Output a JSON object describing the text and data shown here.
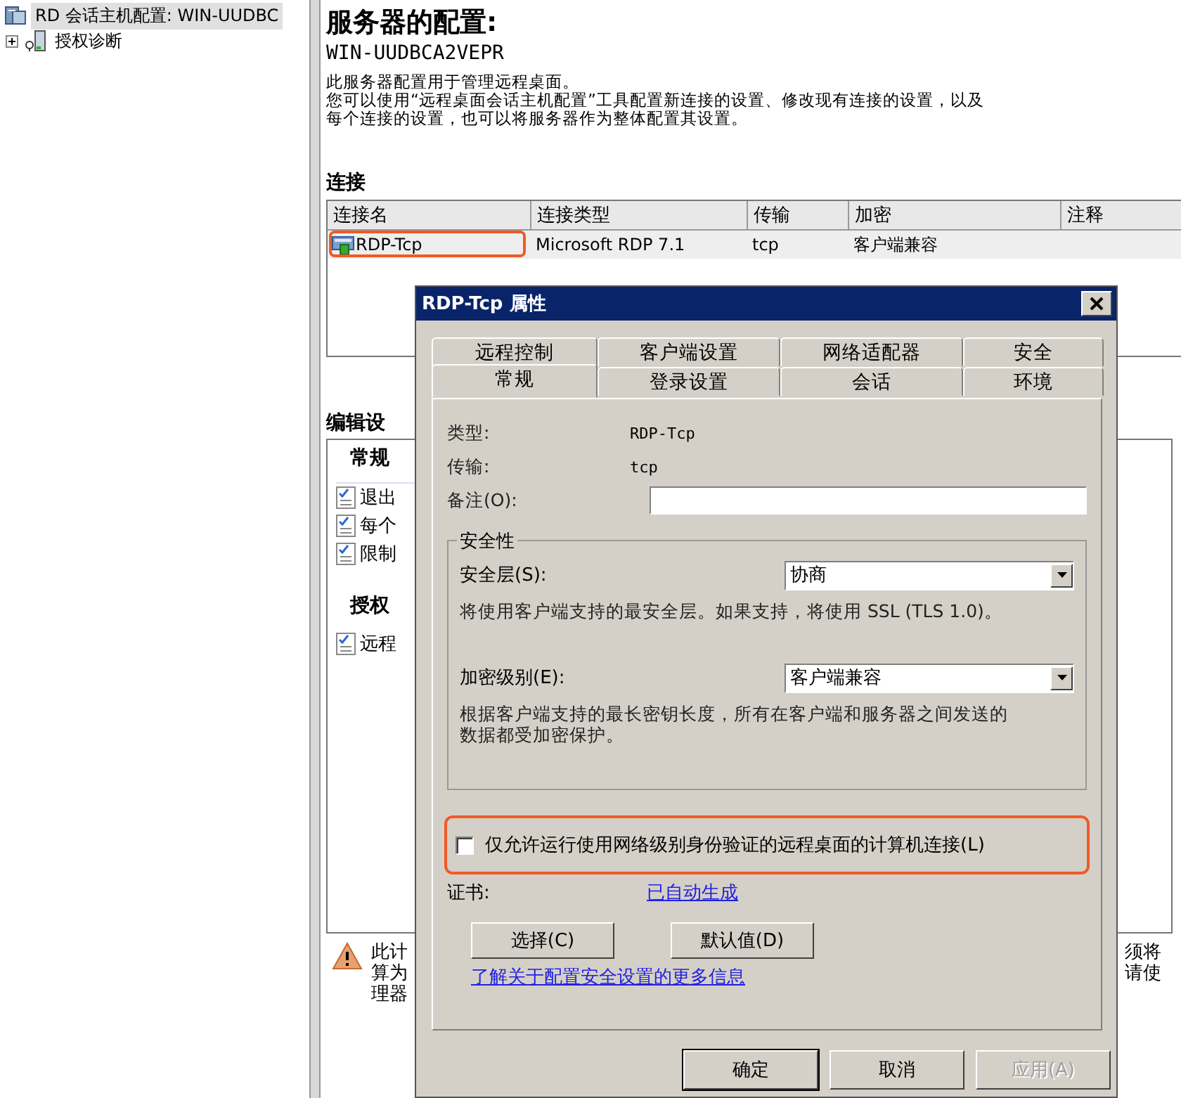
{
  "tree": {
    "items": [
      {
        "label": "RD 会话主机配置: WIN-UUDBC",
        "selected": true,
        "collapsed": false
      },
      {
        "label": "授权诊断",
        "selected": false,
        "collapsed": true
      }
    ]
  },
  "server": {
    "title": "服务器的配置:",
    "name": "WIN-UUDBCA2VEPR",
    "description": [
      "此服务器配置用于管理远程桌面。",
      "您可以使用“远程桌面会话主机配置”工具配置新连接的设置、修改现有连接的设置，以及",
      "每个连接的设置，也可以将服务器作为整体配置其设置。"
    ]
  },
  "connections": {
    "heading": "连接",
    "columns": [
      "连接名",
      "连接类型",
      "传输",
      "加密",
      "注释"
    ],
    "rows": [
      {
        "cells": [
          "RDP-Tcp",
          "Microsoft RDP 7.1",
          "tcp",
          "客户端兼容"
        ],
        "highlighted": true
      }
    ]
  },
  "edit_settings": {
    "heading": "编辑设",
    "groups": [
      {
        "title": "常规",
        "items": [
          "退出",
          "每个",
          "限制"
        ]
      },
      {
        "title": "授权",
        "items": [
          "远程"
        ]
      }
    ]
  },
  "warning": {
    "left_lines": [
      "此计",
      "算为",
      "理器"
    ],
    "right_lines": [
      "须将",
      "请使"
    ]
  },
  "dialog": {
    "title": "RDP-Tcp 属性",
    "tab_rows": [
      [
        {
          "label": "远程控制",
          "selected": false
        },
        {
          "label": "客户端设置",
          "selected": false
        },
        {
          "label": "网络适配器",
          "selected": false
        },
        {
          "label": "安全",
          "selected": false
        }
      ],
      [
        {
          "label": "常规",
          "selected": true
        },
        {
          "label": "登录设置",
          "selected": false
        },
        {
          "label": "会话",
          "selected": false
        },
        {
          "label": "环境",
          "selected": false
        }
      ]
    ],
    "fields": [
      {
        "kind": "readonly",
        "label": "类型:",
        "value": "RDP-Tcp"
      },
      {
        "kind": "readonly",
        "label": "传输:",
        "value": "tcp"
      },
      {
        "kind": "input",
        "label": "备注(O):"
      }
    ],
    "security": {
      "title": "安全性",
      "settings": [
        {
          "label": "安全层(S):",
          "value": "协商",
          "description": "将使用客户端支持的最安全层。如果支持，将使用 SSL (TLS 1.0)。"
        },
        {
          "label": "加密级别(E):",
          "value": "客户端兼容",
          "description": "根据客户端支持的最长密钥长度，所有在客户端和服务器之间发送的数据都受加密保护。"
        }
      ]
    },
    "nla": {
      "label": "仅允许运行使用网络级别身份验证的远程桌面的计算机连接(L)",
      "checked": false,
      "highlighted": true
    },
    "certificate": {
      "label": "证书:",
      "link": "已自动生成"
    },
    "cert_buttons": [
      "选择(C)",
      "默认值(D)"
    ],
    "help_link": "了解关于配置安全设置的更多信息",
    "buttons": [
      {
        "label": "确定",
        "default": true,
        "disabled": false
      },
      {
        "label": "取消",
        "default": false,
        "disabled": false
      },
      {
        "label": "应用(A)",
        "default": false,
        "disabled": true
      }
    ]
  }
}
